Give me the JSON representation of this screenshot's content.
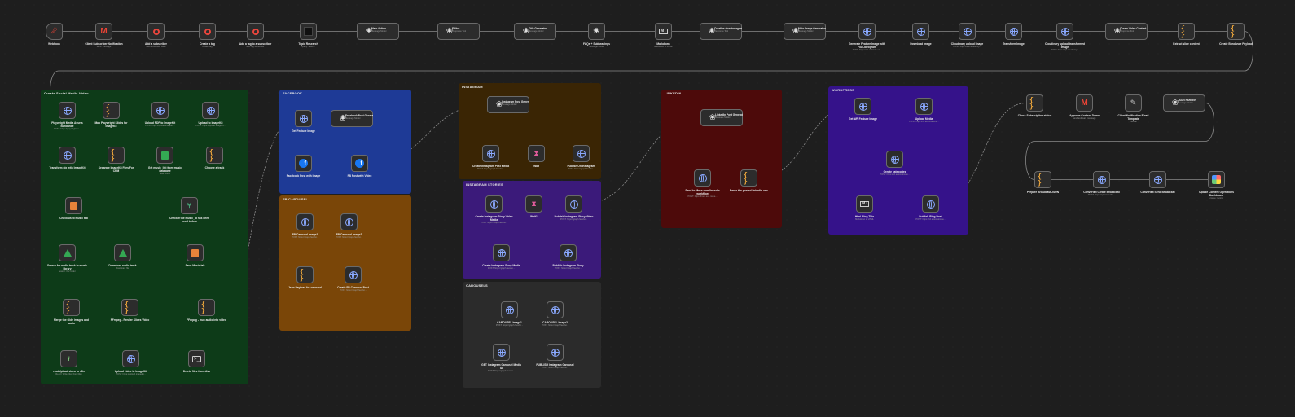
{
  "colors": {
    "social_group": "#0d3b18",
    "facebook_group": "#1e3a96",
    "fb_carousel_group": "#7a4608",
    "instagram_group": "#3a2504",
    "instagram_stories_group": "#3b1a7a",
    "carousels_group": "#2b2b2b",
    "linkedin_group": "#4d0a0a",
    "wordpress_group": "#35128a",
    "wire": "#8a8a8a"
  },
  "groups": {
    "social": "Create Social Media Video",
    "facebook": "FACEBOOK",
    "fb_carousel": "FB CAROUSEL",
    "instagram": "INSTAGRAM",
    "instagram_stories": "INSTAGRAM STORIES",
    "carousels": "CAROUSELS",
    "linkedin": "LINKEDIN",
    "wordpress": "WORDPRESS"
  },
  "nodes": {
    "webhook": {
      "title": "Webhook",
      "sub": "",
      "icon": "webhook-icon"
    },
    "client_sub": {
      "title": "Client Subscriber Notification",
      "sub": "send: message",
      "icon": "gmail-icon"
    },
    "add_sub": {
      "title": "Add a subscriber",
      "sub": "add:subscriber: base",
      "icon": "convertkit-icon"
    },
    "create_tag": {
      "title": "Create a tag",
      "sub": "create: tag",
      "icon": "convertkit-icon"
    },
    "add_tag_sub": {
      "title": "Add a tag to a subscriber",
      "sub": "add: tag:subscriber",
      "icon": "convertkit-icon"
    },
    "topic": {
      "title": "Topic Research",
      "sub": "query: search",
      "icon": "perplexity-icon"
    },
    "main_article": {
      "title": "Main Article",
      "sub": "Message Model",
      "icon": "openai-icon"
    },
    "editor": {
      "title": "Editor",
      "sub": "Response Tool",
      "icon": "openai-icon"
    },
    "title_gen": {
      "title": "Title Generator",
      "sub": "Message Model",
      "icon": "openai-icon"
    },
    "faqs": {
      "title": "FAQs + Subheadings",
      "sub": "Message Model",
      "icon": "openai-icon"
    },
    "markdown": {
      "title": "Markdown",
      "sub": "Markdown to HTML",
      "icon": "markdown-icon"
    },
    "creative": {
      "title": "Creative director agent",
      "sub": "Response Tool",
      "icon": "openai-icon"
    },
    "main_image": {
      "title": "Main Image Generation...",
      "sub": "Message Model",
      "icon": "openai-icon"
    },
    "gen_feature": {
      "title": "Generate Feature Image with Flux-Ideogram",
      "sub": "POST: https://api.replicate.co...",
      "icon": "globe-icon"
    },
    "download": {
      "title": "Download Image",
      "sub": "",
      "icon": "globe-icon"
    },
    "cloud_up": {
      "title": "Cloudinary upload Image",
      "sub": "POST: https://api.cloudinary...",
      "icon": "globe-icon"
    },
    "transform": {
      "title": "Transform Image",
      "sub": "",
      "icon": "globe-icon"
    },
    "cloud_up2": {
      "title": "Cloudinary upload transformed Image",
      "sub": "POST: https://api.cloudinary...",
      "icon": "globe-icon"
    },
    "create_video": {
      "title": "Create Video Content",
      "sub": "Response Tool",
      "icon": "openai-icon"
    },
    "extract": {
      "title": "Extract slide content",
      "sub": "",
      "icon": "code-icon"
    },
    "create_bundle": {
      "title": "Create Bundance Payload",
      "sub": "",
      "icon": "code-icon"
    },
    "s1": {
      "title": "Playwright Media Assets Bundance",
      "sub": "POST: https://playwright-m...",
      "icon": "globe-icon"
    },
    "s2": {
      "title": "Map Playwright Slides for ImageKit",
      "sub": "",
      "icon": "code-icon"
    },
    "s3": {
      "title": "Upload PDF to ImageKit",
      "sub": "POST: https://upload.imagekit...",
      "icon": "globe-icon"
    },
    "s4": {
      "title": "Upload to ImageKit",
      "sub": "POST: https://upload.imagekit...",
      "icon": "globe-icon"
    },
    "s5": {
      "title": "Transform pix with ImageKit",
      "sub": "",
      "icon": "globe-icon"
    },
    "s6": {
      "title": "Separate ImageKit Files For CRM",
      "sub": "",
      "icon": "code-icon"
    },
    "s7": {
      "title": "Get music_list from music database",
      "sub": "read: sheet",
      "icon": "sheets-icon"
    },
    "s8": {
      "title": "Choose a track",
      "sub": "",
      "icon": "code-icon"
    },
    "s9": {
      "title": "Check used music tab",
      "sub": "",
      "icon": "table-icon"
    },
    "s10": {
      "title": "Check if the music_id has been used before",
      "sub": "",
      "icon": "branch-icon"
    },
    "s11": {
      "title": "Search for audio track in music library",
      "sub": "search: file/ folder",
      "icon": "drive-icon"
    },
    "s12": {
      "title": "Download audio track",
      "sub": "download: file",
      "icon": "drive-icon"
    },
    "s13": {
      "title": "Save Music tab",
      "sub": "",
      "icon": "table-icon"
    },
    "s14": {
      "title": "Merge the slide images and audio",
      "sub": "",
      "icon": "code-icon"
    },
    "s15": {
      "title": "FFmpeg - Render Slides Video",
      "sub": "",
      "icon": "code-icon"
    },
    "s16": {
      "title": "FFmpeg - mux audio into video",
      "sub": "",
      "icon": "code-icon"
    },
    "s17": {
      "title": "readUpload video to n8n",
      "sub": "Read / Write Files from Disk",
      "icon": "upload-icon"
    },
    "s18": {
      "title": "Upload video to ImageKit",
      "sub": "POST: https://upload.imagekit...",
      "icon": "globe-icon"
    },
    "s19": {
      "title": "Delete files from disk",
      "sub": "",
      "icon": "terminal-icon"
    },
    "fb1": {
      "title": "Get Feature Image",
      "sub": "",
      "icon": "globe-icon"
    },
    "fb2": {
      "title": "Facebook Post Generator",
      "sub": "Message Model",
      "icon": "openai-icon"
    },
    "fb3": {
      "title": "Facebook Post with Image",
      "sub": "",
      "icon": "facebook-icon"
    },
    "fb4": {
      "title": "FB Post with Video",
      "sub": "",
      "icon": "facebook-icon"
    },
    "fc1": {
      "title": "FB Carousel Image1",
      "sub": "POST: https://graph.facebo...",
      "icon": "globe-icon"
    },
    "fc2": {
      "title": "FB Carousel Image2",
      "sub": "POST: https://graph.facebo...",
      "icon": "globe-icon"
    },
    "fc3": {
      "title": "Json Payload for carousel",
      "sub": "",
      "icon": "code-icon"
    },
    "fc4": {
      "title": "Create FB Carousel Post",
      "sub": "POST: https://graph.facebo...",
      "icon": "globe-icon"
    },
    "ig1": {
      "title": "Instagram Post Generator",
      "sub": "Message Model",
      "icon": "openai-icon"
    },
    "ig2": {
      "title": "Create Instagram Post Media",
      "sub": "POST: https://graph.facebo...",
      "icon": "globe-icon"
    },
    "ig3": {
      "title": "Wait",
      "sub": "",
      "icon": "wait-icon"
    },
    "ig4": {
      "title": "Publish On Instagram",
      "sub": "POST: https://graph.facebo...",
      "icon": "globe-icon"
    },
    "is1": {
      "title": "Create Instagram Story Video Media",
      "sub": "POST: https://graph.facebo...",
      "icon": "globe-icon"
    },
    "is2": {
      "title": "Wait1",
      "sub": "",
      "icon": "wait-icon"
    },
    "is3": {
      "title": "Publish Instagram Story Video",
      "sub": "POST: https://graph.facebo...",
      "icon": "globe-icon"
    },
    "is4": {
      "title": "Create Instagram Story Media",
      "sub": "POST: https://graph.facebo...",
      "icon": "globe-icon"
    },
    "is5": {
      "title": "Publish Instagram Story",
      "sub": "POST: https://graph.facebo...",
      "icon": "globe-icon"
    },
    "ca1": {
      "title": "CAROUSEL Image1",
      "sub": "POST: https://graph.facebo...",
      "icon": "globe-icon"
    },
    "ca2": {
      "title": "CAROUSEL Image2",
      "sub": "POST: https://graph.facebo...",
      "icon": "globe-icon"
    },
    "ca3": {
      "title": "GET Instagram Carousel Media ID",
      "sub": "POST: https://graph.facebo...",
      "icon": "globe-icon"
    },
    "ca4": {
      "title": "PUBLISH Instagram Carousel",
      "sub": "POST: https://graph.facebo...",
      "icon": "globe-icon"
    },
    "li1": {
      "title": "LinkedIn Post Generator",
      "sub": "Message Model",
      "icon": "openai-icon"
    },
    "li2": {
      "title": "Send to Make.com linkedin workflow",
      "sub": "POST: https://hook.eu2.make...",
      "icon": "globe-icon"
    },
    "li3": {
      "title": "Parse the posted linkedin urls",
      "sub": "",
      "icon": "code-icon"
    },
    "wp1": {
      "title": "Get WP Feature Image",
      "sub": "",
      "icon": "globe-icon"
    },
    "wp2": {
      "title": "Upload Media",
      "sub": "POST: https://sh.automationw...",
      "icon": "globe-icon"
    },
    "wp3": {
      "title": "Create categories",
      "sub": "POST: https://sh.automationw...",
      "icon": "globe-icon"
    },
    "wp4": {
      "title": "Html Blog Title",
      "sub": "Markdown to HTML",
      "icon": "markdown-icon"
    },
    "wp5": {
      "title": "Publish Blog Post",
      "sub": "POST: https://sh.automationw...",
      "icon": "globe-icon"
    },
    "r1": {
      "title": "Check Subscription status",
      "sub": "",
      "icon": "code-icon"
    },
    "r2": {
      "title": "Approve Content Demo",
      "sub": "send:and:wait: message",
      "icon": "gmail-icon"
    },
    "r3": {
      "title": "Client Notification Email Template",
      "sub": "manual",
      "icon": "edit-icon"
    },
    "r4": {
      "title": "JSON PARSER",
      "sub": "Message Model",
      "icon": "openai-icon"
    },
    "r5": {
      "title": "Prepare Broadcast JSON",
      "sub": "",
      "icon": "code-icon"
    },
    "r6": {
      "title": "Convertkit Create Broadcast",
      "sub": "POST: https://api.convertkit...",
      "icon": "globe-icon"
    },
    "r7": {
      "title": "Convertkit Send Broadcast",
      "sub": "",
      "icon": "globe-icon"
    },
    "r8": {
      "title": "Update Content Operations Dashboard",
      "sub": "create: record",
      "icon": "airtable-icon"
    }
  }
}
